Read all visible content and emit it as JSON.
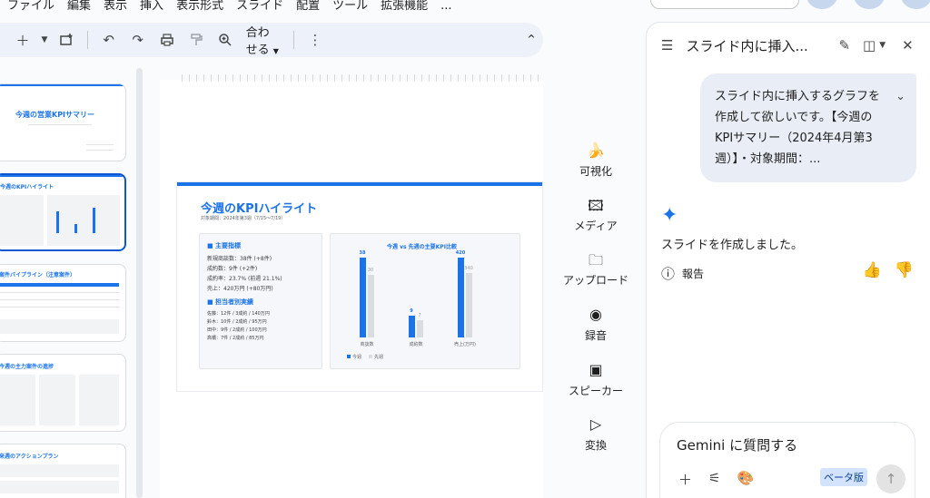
{
  "menu": [
    "ファイル",
    "編集",
    "表示",
    "挿入",
    "表示形式",
    "スライド",
    "配置",
    "ツール",
    "拡張機能",
    "..."
  ],
  "toolbar": {
    "zoom_label": "合わせる"
  },
  "thumbnails": [
    {
      "title": "今週の営業KPIサマリー"
    },
    {
      "title": "今週のKPIハイライト"
    },
    {
      "title": "案件パイプライン（注意案件）"
    },
    {
      "title": "今週の主力案件の進捗"
    },
    {
      "title": "来週のアクションプラン"
    }
  ],
  "slide": {
    "title": "今週のKPIハイライト",
    "subtitle": "対象期間：2024年第3週（7/15〜7/19）",
    "card1_heading": "■ 主要指標",
    "card1_lines": [
      "新規商談数：38件 (+8件)",
      "成約数：9件 (+2件)",
      "成約率：23.7% (前週 21.1%)",
      "売上：420万円 (+80万円)"
    ],
    "card2_heading": "■ 担当者別実績",
    "card2_lines": [
      "佐藤：12件 / 3成約 / 140万円",
      "鈴木：10件 / 2成約 / 95万円",
      "田中：9件 / 2成約 / 100万円",
      "高橋：7件 / 2成約 / 85万円"
    ],
    "chart": {
      "title": "今週 vs 先週の主要KPI比較",
      "legend_current": "今週",
      "legend_prev": "先週"
    }
  },
  "chart_data": {
    "type": "bar",
    "title": "今週 vs 先週の主要KPI比較",
    "categories": [
      "商談数",
      "成約数",
      "売上(万円)"
    ],
    "series": [
      {
        "name": "今週",
        "values": [
          38,
          9,
          420
        ]
      },
      {
        "name": "先週",
        "values": [
          30,
          7,
          340
        ]
      }
    ],
    "colors": [
      "#1a73e8",
      "#dadce0"
    ]
  },
  "insert_panel": [
    {
      "label": "可視化",
      "icon": "banana-icon"
    },
    {
      "label": "メディア",
      "icon": "media-icon"
    },
    {
      "label": "アップロード",
      "icon": "folder-icon"
    },
    {
      "label": "録音",
      "icon": "record-icon"
    },
    {
      "label": "スピーカー",
      "icon": "speaker-icon"
    },
    {
      "label": "変換",
      "icon": "convert-icon"
    }
  ],
  "gemini": {
    "title": "スライド内に挿入...",
    "prompt": "スライド内に挿入するグラフを作成して欲しいです。【今週のKPIサマリー（2024年4月第3週）】・対象期間：...",
    "response": "スライドを作成しました。",
    "report_label": "報告",
    "input_placeholder": "Gemini に質問する",
    "beta_label": "ベータ版"
  }
}
